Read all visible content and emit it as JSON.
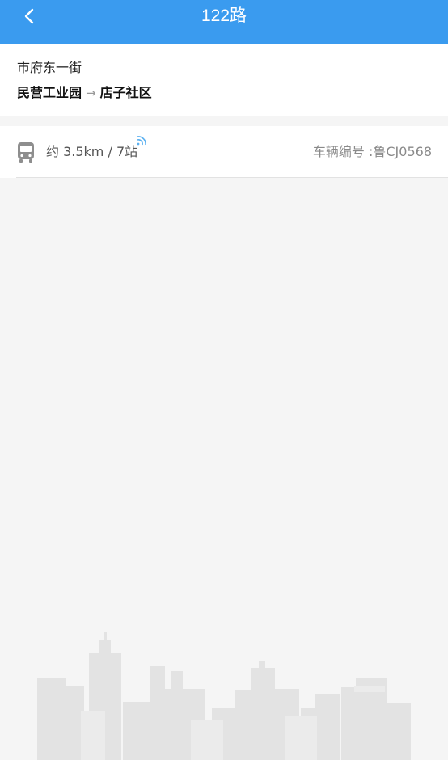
{
  "header": {
    "title": "122路",
    "back_icon": "chevron-left-icon",
    "bg_color": "#3a9bef"
  },
  "station": {
    "name": "市府东一街",
    "from": "民营工业园",
    "arrow": "→",
    "to": "店子社区"
  },
  "bus": {
    "icon": "bus-icon",
    "distance": "约 3.5km / 7站",
    "signal_icon": "signal-icon",
    "signal_color": "#5ab0f0",
    "plate": "车辆编号 :鲁CJ0568"
  },
  "background": {
    "illustration": "city-skyline"
  }
}
